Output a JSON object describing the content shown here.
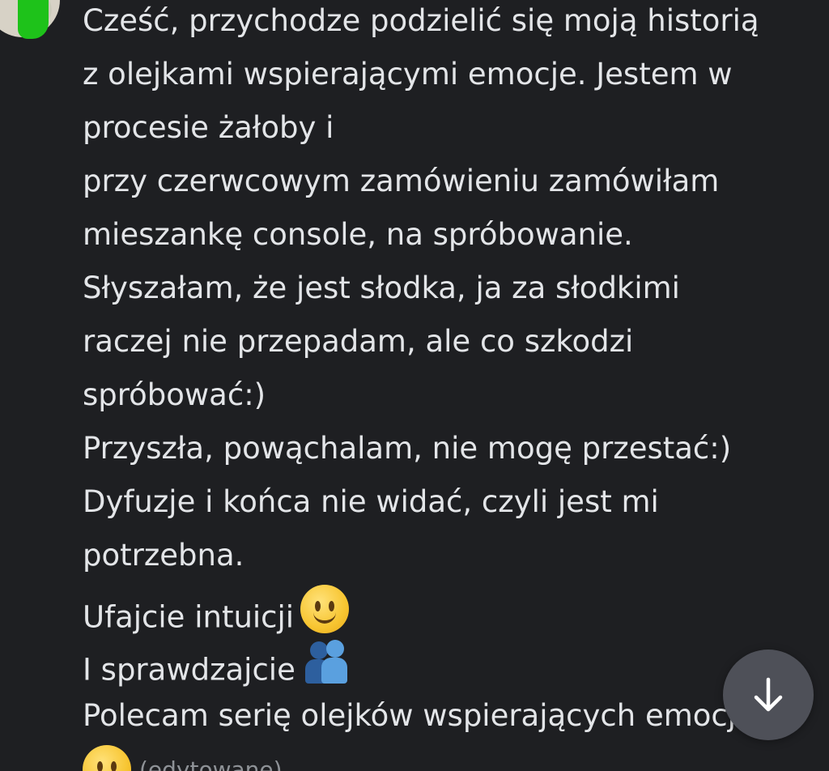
{
  "message": {
    "lines": [
      "Cześć, przychodze podzielić się moją historią",
      "z olejkami wspierającymi emocje. Jestem w",
      "procesie żałoby i",
      "przy czerwcowym zamówieniu zamówiłam",
      "mieszankę console, na spróbowanie.",
      "Słyszałam, że jest słodka, ja za słodkimi",
      "raczej nie przepadam, ale co szkodzi",
      "spróbować:)",
      "Przyszła, powąchalam, nie mogę przestać:)",
      "Dyfuzje i końca nie widać, czyli jest mi",
      "potrzebna.",
      "Ufajcie intuicji",
      "I sprawdzajcie",
      "Polecam serię olejków wspierających emocje"
    ],
    "edited_label": "(edytowane)"
  },
  "emojis": {
    "smile": "slightly-smiling-face",
    "hug": "people-hugging"
  },
  "scroll_button": {
    "icon": "arrow-down-icon"
  },
  "colors": {
    "background": "#1e1f22",
    "text": "#e3e5e8",
    "muted": "#8e9297",
    "button": "#4e5058"
  }
}
